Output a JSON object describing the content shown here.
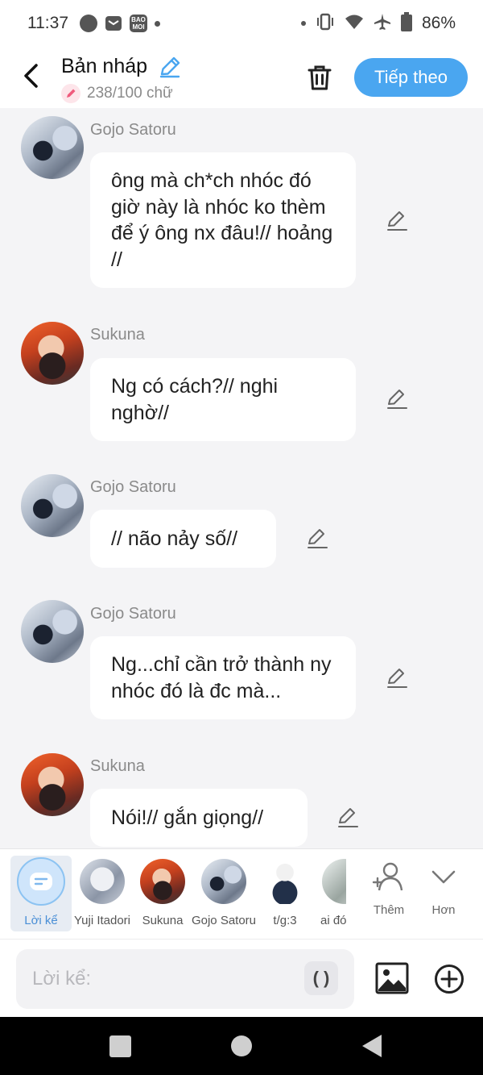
{
  "status_bar": {
    "time": "11:37",
    "app_icon_label": "BAO MOI",
    "battery_percent": "86%"
  },
  "header": {
    "title": "Bản nháp",
    "word_count": "238/100 chữ",
    "next_label": "Tiếp theo"
  },
  "messages": [
    {
      "sender": "Gojo Satoru",
      "text": "ông mà ch*ch nhóc đó giờ này là nhóc ko thèm để ý ông nx đâu!// hoảng //"
    },
    {
      "sender": "Sukuna",
      "text": "Ng có cách?// nghi nghờ//"
    },
    {
      "sender": "Gojo Satoru",
      "text": "// não nảy số//"
    },
    {
      "sender": "Gojo Satoru",
      "text": "Ng...chỉ cần trở thành ny nhóc đó là đc mà..."
    },
    {
      "sender": "Sukuna",
      "text": "Nói!// gắn giọng//"
    }
  ],
  "characters": [
    {
      "label": "Lời kể"
    },
    {
      "label": "Yuji Itadori"
    },
    {
      "label": "Sukuna"
    },
    {
      "label": "Gojo Satoru"
    },
    {
      "label": "t/g:3"
    },
    {
      "label": "ai đó"
    }
  ],
  "strip_actions": {
    "add_label": "Thêm",
    "more_label": "Hơn"
  },
  "input": {
    "placeholder": "Lời kể:",
    "paren_label": "( )"
  },
  "colors": {
    "accent": "#4aa6f0",
    "background": "#f4f4f6",
    "bubble": "#ffffff"
  }
}
